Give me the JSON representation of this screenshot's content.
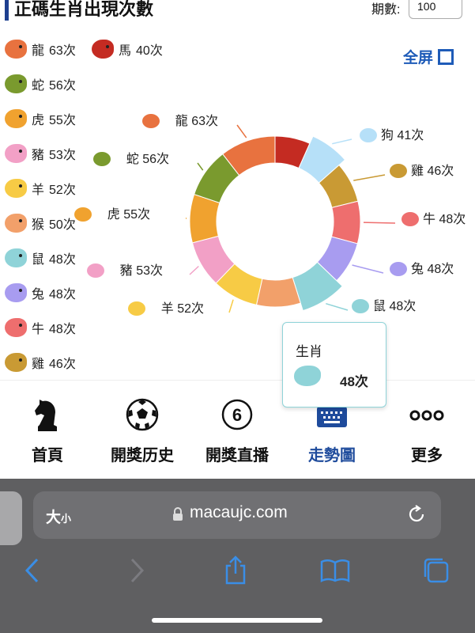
{
  "header": {
    "title": "正碼生肖出現次數",
    "periods_label": "期數:",
    "periods_value": "100",
    "fullscreen_label": "全屏"
  },
  "legend": [
    {
      "name": "龍",
      "count": "63次",
      "color": "#e8723f"
    },
    {
      "name": "馬",
      "count": "40次",
      "color": "#c42b22"
    },
    {
      "name": "蛇",
      "count": "56次",
      "color": "#7a9a2e"
    },
    {
      "name": "虎",
      "count": "55次",
      "color": "#f0a22f"
    },
    {
      "name": "豬",
      "count": "53次",
      "color": "#f2a0c6"
    },
    {
      "name": "羊",
      "count": "52次",
      "color": "#f7cb45"
    },
    {
      "name": "猴",
      "count": "50次",
      "color": "#f2a06a"
    },
    {
      "name": "鼠",
      "count": "48次",
      "color": "#8fd3d8"
    },
    {
      "name": "兔",
      "count": "48次",
      "color": "#a89cf0"
    },
    {
      "name": "牛",
      "count": "48次",
      "color": "#ee6e6e"
    },
    {
      "name": "雞",
      "count": "46次",
      "color": "#c99a34"
    }
  ],
  "chart_data": {
    "type": "pie",
    "donut": true,
    "categories": [
      "馬",
      "狗",
      "雞",
      "牛",
      "兔",
      "鼠",
      "猴",
      "羊",
      "豬",
      "虎",
      "蛇",
      "龍"
    ],
    "values": [
      40,
      41,
      46,
      48,
      48,
      48,
      50,
      52,
      53,
      55,
      56,
      63
    ],
    "labels": [
      "",
      "狗 41次",
      "雞 46次",
      "牛 48次",
      "兔 48次",
      "鼠 48次",
      "",
      "羊 52次",
      "豬 53次",
      "虎 55次",
      "蛇 56次",
      "龍 63次"
    ],
    "colors": [
      "#c42b22",
      "#b6e0f8",
      "#c99a34",
      "#ee6e6e",
      "#a89cf0",
      "#8fd3d8",
      "#f2a06a",
      "#f7cb45",
      "#f2a0c6",
      "#f0a22f",
      "#7a9a2e",
      "#e8723f"
    ],
    "highlighted": [
      "狗",
      "鼠"
    ]
  },
  "tooltip": {
    "title": "生肖",
    "value": "48次"
  },
  "bottom_nav": [
    {
      "label": "首頁",
      "icon": "chess-knight-icon"
    },
    {
      "label": "開獎历史",
      "icon": "soccer-ball-icon"
    },
    {
      "label": "開獎直播",
      "icon": "circled-six-icon"
    },
    {
      "label": "走勢圖",
      "icon": "keyboard-chart-icon",
      "active": true
    },
    {
      "label": "更多",
      "icon": "more-dots-icon"
    }
  ],
  "browser": {
    "text_size": "大",
    "text_size_small": "小",
    "url": "macaujc.com"
  },
  "colors": {
    "accent": "#1e4b9c",
    "link": "#1e5bb8",
    "browser_bg": "#5f5f61",
    "browser_icon": "#3a8ee6"
  }
}
